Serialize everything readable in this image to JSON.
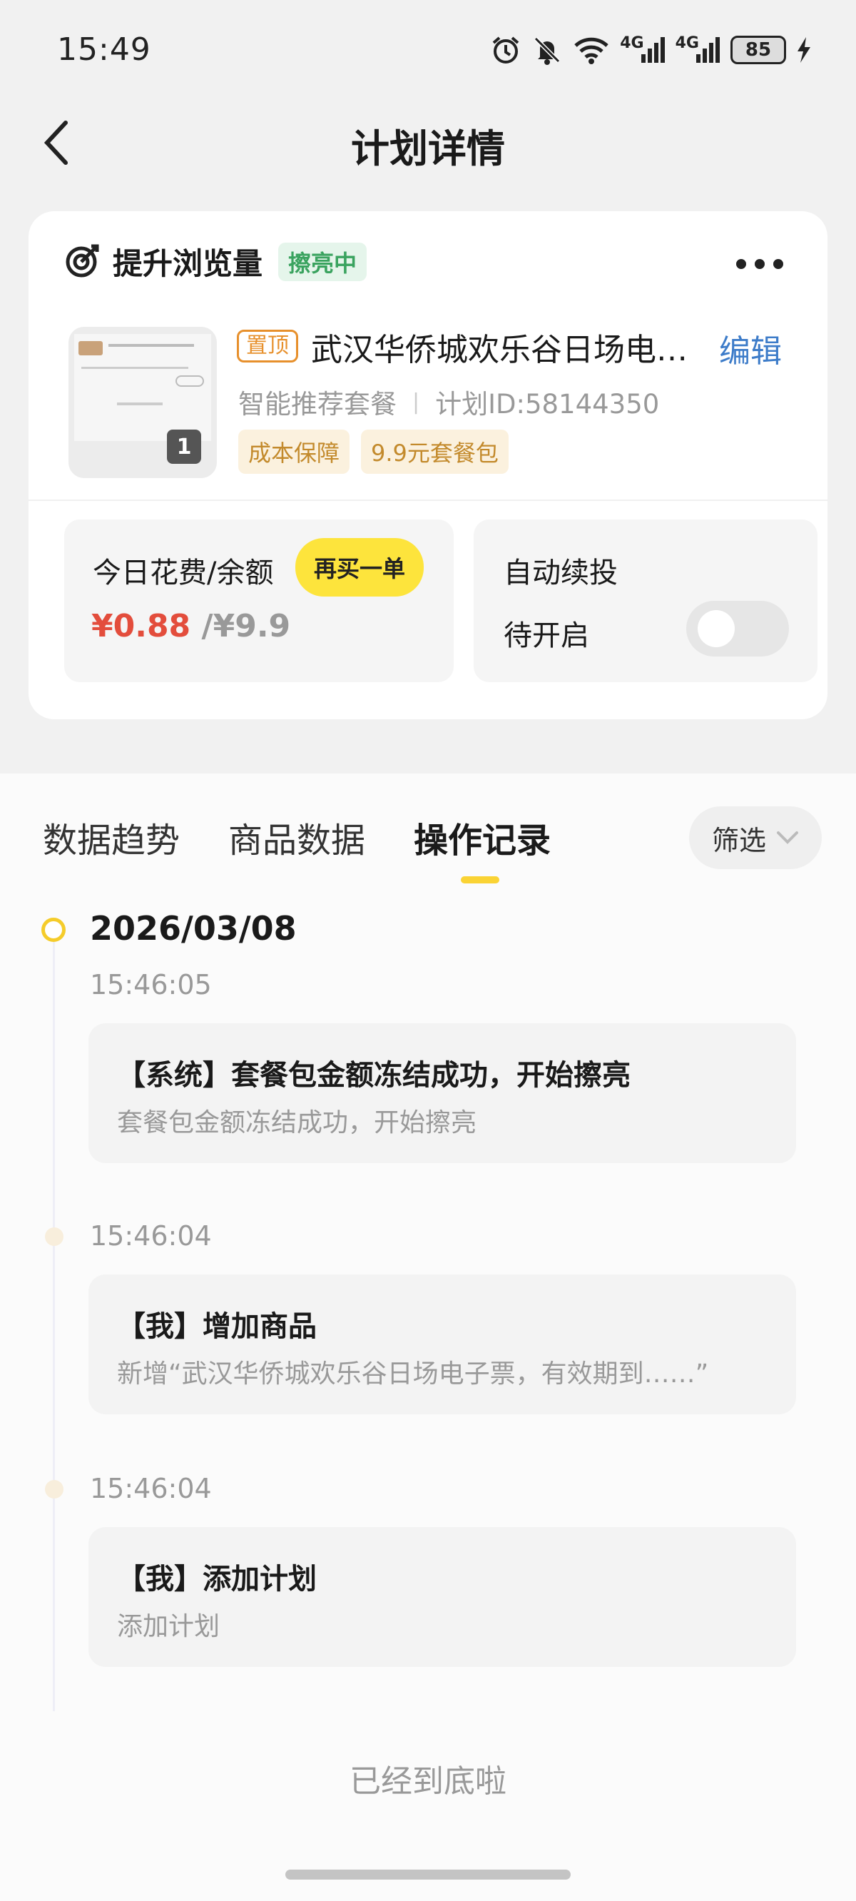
{
  "status_bar": {
    "time": "15:49",
    "sig1": "4G",
    "sig2": "4G",
    "battery": "85"
  },
  "header": {
    "title": "计划详情"
  },
  "plan": {
    "type_title": "提升浏览量",
    "status_badge": "擦亮中",
    "top_tag": "置顶",
    "product_title": "武汉华侨城欢乐谷日场电子票，有效期到……",
    "edit_label": "编辑",
    "package": "智能推荐套餐",
    "plan_id": "计划ID:58144350",
    "tags": [
      "成本保障",
      "9.9元套餐包"
    ],
    "thumb_count": "1"
  },
  "spend": {
    "label": "今日花费/余额",
    "buy_label": "再买一单",
    "spent": "¥0.88",
    "balance": "/¥9.9"
  },
  "auto_renew": {
    "label": "自动续投",
    "status": "待开启",
    "enabled": false
  },
  "tabs": [
    {
      "label": "数据趋势"
    },
    {
      "label": "商品数据"
    },
    {
      "label": "操作记录"
    }
  ],
  "active_tab": 2,
  "filter_label": "筛选",
  "timeline": {
    "date": "2026/03/08",
    "entries": [
      {
        "time": "15:46:05",
        "title": "【系统】套餐包金额冻结成功，开始擦亮",
        "desc": "套餐包金额冻结成功，开始擦亮"
      },
      {
        "time": "15:46:04",
        "title": "【我】增加商品",
        "desc": "新增“武汉华侨城欢乐谷日场电子票，有效期到……”"
      },
      {
        "time": "15:46:04",
        "title": "【我】添加计划",
        "desc": "添加计划"
      }
    ]
  },
  "footer_note": "已经到底啦",
  "colors": {
    "accent_yellow": "#fde43c",
    "price_red": "#e34d3c",
    "link_blue": "#3d7cc9",
    "tag_orange": "#e7902c",
    "status_green": "#3aa35f"
  }
}
